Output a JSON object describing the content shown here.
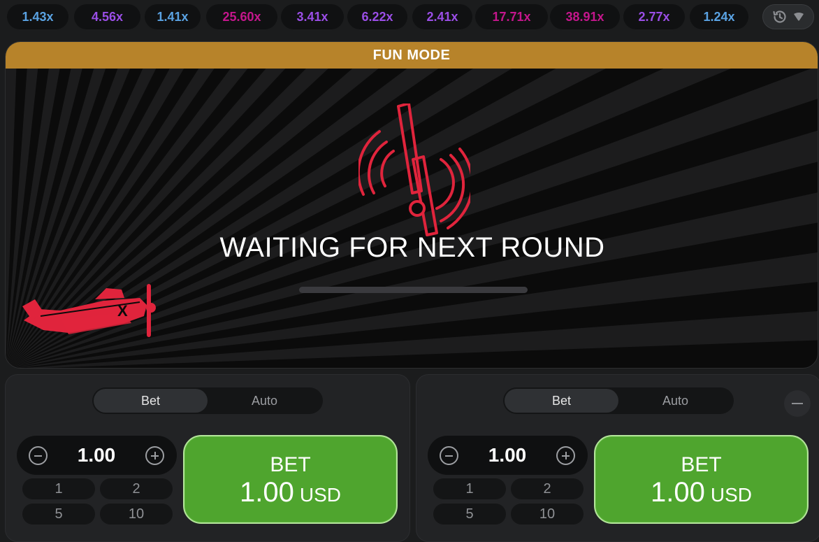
{
  "history": {
    "multipliers": [
      {
        "value": "1.43x",
        "color": "#5aa2e2"
      },
      {
        "value": "4.56x",
        "color": "#9a4ee6"
      },
      {
        "value": "1.41x",
        "color": "#5aa2e2"
      },
      {
        "value": "25.60x",
        "color": "#c4168c"
      },
      {
        "value": "3.41x",
        "color": "#9a4ee6"
      },
      {
        "value": "6.22x",
        "color": "#9a4ee6"
      },
      {
        "value": "2.41x",
        "color": "#9a4ee6"
      },
      {
        "value": "17.71x",
        "color": "#c4168c"
      },
      {
        "value": "38.91x",
        "color": "#c4168c"
      },
      {
        "value": "2.77x",
        "color": "#9a4ee6"
      },
      {
        "value": "1.24x",
        "color": "#5aa2e2"
      }
    ],
    "history_button_icons": [
      "history-icon",
      "chevron-down-icon"
    ]
  },
  "game": {
    "mode_banner": "FUN MODE",
    "status_text": "WAITING FOR NEXT ROUND",
    "progress": 0,
    "accent_color": "#e0243c",
    "banner_color": "#b7832a"
  },
  "panels": [
    {
      "tabs": {
        "bet": "Bet",
        "auto": "Auto",
        "active": "Bet"
      },
      "amount": "1.00",
      "quick_amounts": [
        "1",
        "2",
        "5",
        "10"
      ],
      "bet_button": {
        "label": "BET",
        "amount": "1.00",
        "currency": "USD"
      }
    },
    {
      "tabs": {
        "bet": "Bet",
        "auto": "Auto",
        "active": "Bet"
      },
      "amount": "1.00",
      "quick_amounts": [
        "1",
        "2",
        "5",
        "10"
      ],
      "bet_button": {
        "label": "BET",
        "amount": "1.00",
        "currency": "USD"
      },
      "remove_panel_icon": "minus-icon"
    }
  ],
  "colors": {
    "bet_green": "#4fa52e",
    "background": "#1b1c1d"
  }
}
